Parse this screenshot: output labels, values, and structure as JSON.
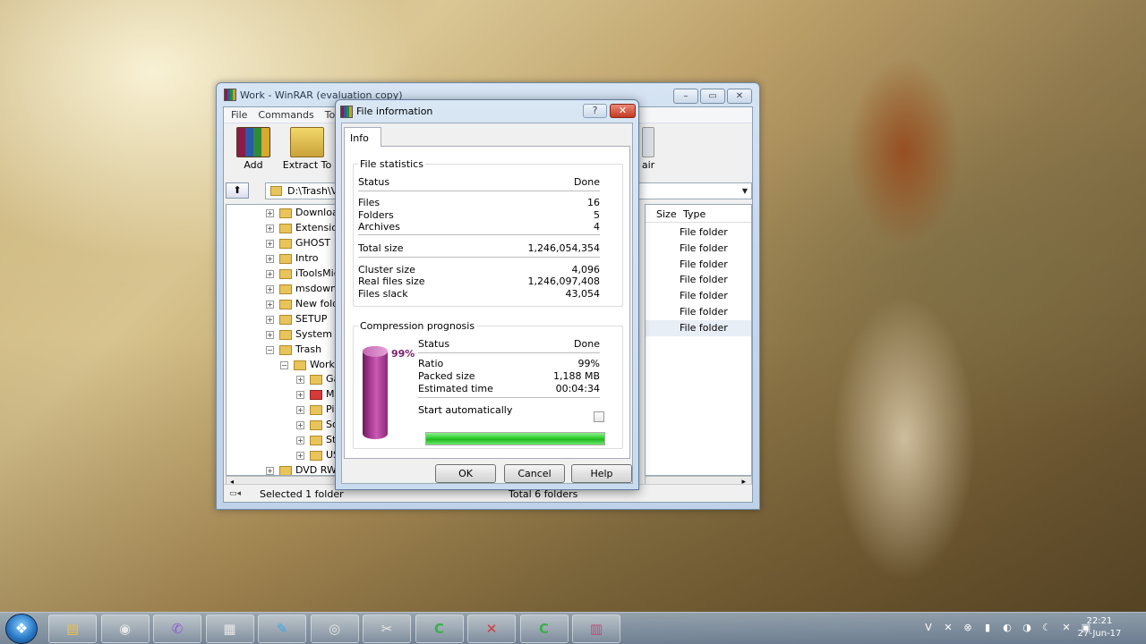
{
  "winrar": {
    "title": "Work - WinRAR (evaluation copy)",
    "window_buttons": {
      "minimize": "▭",
      "maximize": "▭",
      "close": "✕"
    },
    "menu": [
      "File",
      "Commands",
      "Too"
    ],
    "toolbar": {
      "add_label": "Add",
      "extract_label": "Extract To",
      "repair_label": "air"
    },
    "address": {
      "path": "D:\\Trash\\V"
    },
    "tree": [
      {
        "label": "Download",
        "expander": "+"
      },
      {
        "label": "Extension",
        "expander": "+"
      },
      {
        "label": "GHOST",
        "expander": "+"
      },
      {
        "label": "Intro",
        "expander": "+"
      },
      {
        "label": "iToolsMig",
        "expander": "+"
      },
      {
        "label": "msdownl",
        "expander": "+"
      },
      {
        "label": "New folde",
        "expander": "+"
      },
      {
        "label": "SETUP",
        "expander": "+"
      },
      {
        "label": "System V",
        "expander": "+"
      },
      {
        "label": "Trash",
        "expander": "−"
      },
      {
        "label": "Work",
        "expander": "−"
      },
      {
        "label": "Ga",
        "expander": "+"
      },
      {
        "label": "M",
        "expander": "+"
      },
      {
        "label": "Pi",
        "expander": "+"
      },
      {
        "label": "So",
        "expander": "+"
      },
      {
        "label": "Sti",
        "expander": "+"
      },
      {
        "label": "US",
        "expander": "+"
      },
      {
        "label": "DVD RW D",
        "expander": "+"
      }
    ],
    "list": {
      "columns": {
        "size": "Size",
        "type": "Type"
      },
      "rows": [
        "File folder",
        "File folder",
        "File folder",
        "File folder",
        "File folder",
        "File folder",
        "File folder"
      ]
    },
    "status": {
      "selected": "Selected 1 folder",
      "total": "Total 6 folders"
    }
  },
  "dialog": {
    "title": "File information",
    "help_button": "?",
    "close_button": "✕",
    "tab": "Info",
    "stats": {
      "group_label": "File statistics",
      "status_label": "Status",
      "status_value": "Done",
      "files_label": "Files",
      "files_value": "16",
      "folders_label": "Folders",
      "folders_value": "5",
      "archives_label": "Archives",
      "archives_value": "4",
      "total_size_label": "Total size",
      "total_size_value": "1,246,054,354",
      "cluster_size_label": "Cluster size",
      "cluster_size_value": "4,096",
      "real_files_size_label": "Real files size",
      "real_files_size_value": "1,246,097,408",
      "files_slack_label": "Files slack",
      "files_slack_value": "43,054"
    },
    "prognosis": {
      "group_label": "Compression prognosis",
      "percent": "99%",
      "status_label": "Status",
      "status_value": "Done",
      "ratio_label": "Ratio",
      "ratio_value": "99%",
      "packed_label": "Packed size",
      "packed_value": "1,188 MB",
      "estimated_label": "Estimated time",
      "estimated_value": "00:04:34",
      "start_auto_label": "Start automatically",
      "start_auto_checked": false,
      "progress": 1.0
    },
    "buttons": {
      "ok": "OK",
      "cancel": "Cancel",
      "help": "Help"
    }
  },
  "taskbar": {
    "start_glyph": "❖",
    "apps": [
      {
        "name": "explorer",
        "glyph": "▤"
      },
      {
        "name": "chrome",
        "glyph": "◉"
      },
      {
        "name": "viber",
        "glyph": "✆"
      },
      {
        "name": "app",
        "glyph": "▦"
      },
      {
        "name": "feather",
        "glyph": "✎"
      },
      {
        "name": "camera",
        "glyph": "◎"
      },
      {
        "name": "tool",
        "glyph": "✂"
      },
      {
        "name": "camtasia",
        "glyph": "C"
      },
      {
        "name": "red-app",
        "glyph": "✕"
      },
      {
        "name": "camtasia-2",
        "glyph": "C"
      },
      {
        "name": "winrar",
        "glyph": "▥"
      }
    ],
    "tray_glyphs": [
      "V",
      "✕",
      "⊗",
      "▮",
      "◐",
      "◑",
      "☾",
      "✕",
      "▣"
    ],
    "time": "22:21",
    "date": "27-Jun-17"
  },
  "colors": {
    "progress_green": "#2fd02f",
    "cylinder_purple": "#a83a92",
    "accent_blue": "#2a7ac8"
  }
}
